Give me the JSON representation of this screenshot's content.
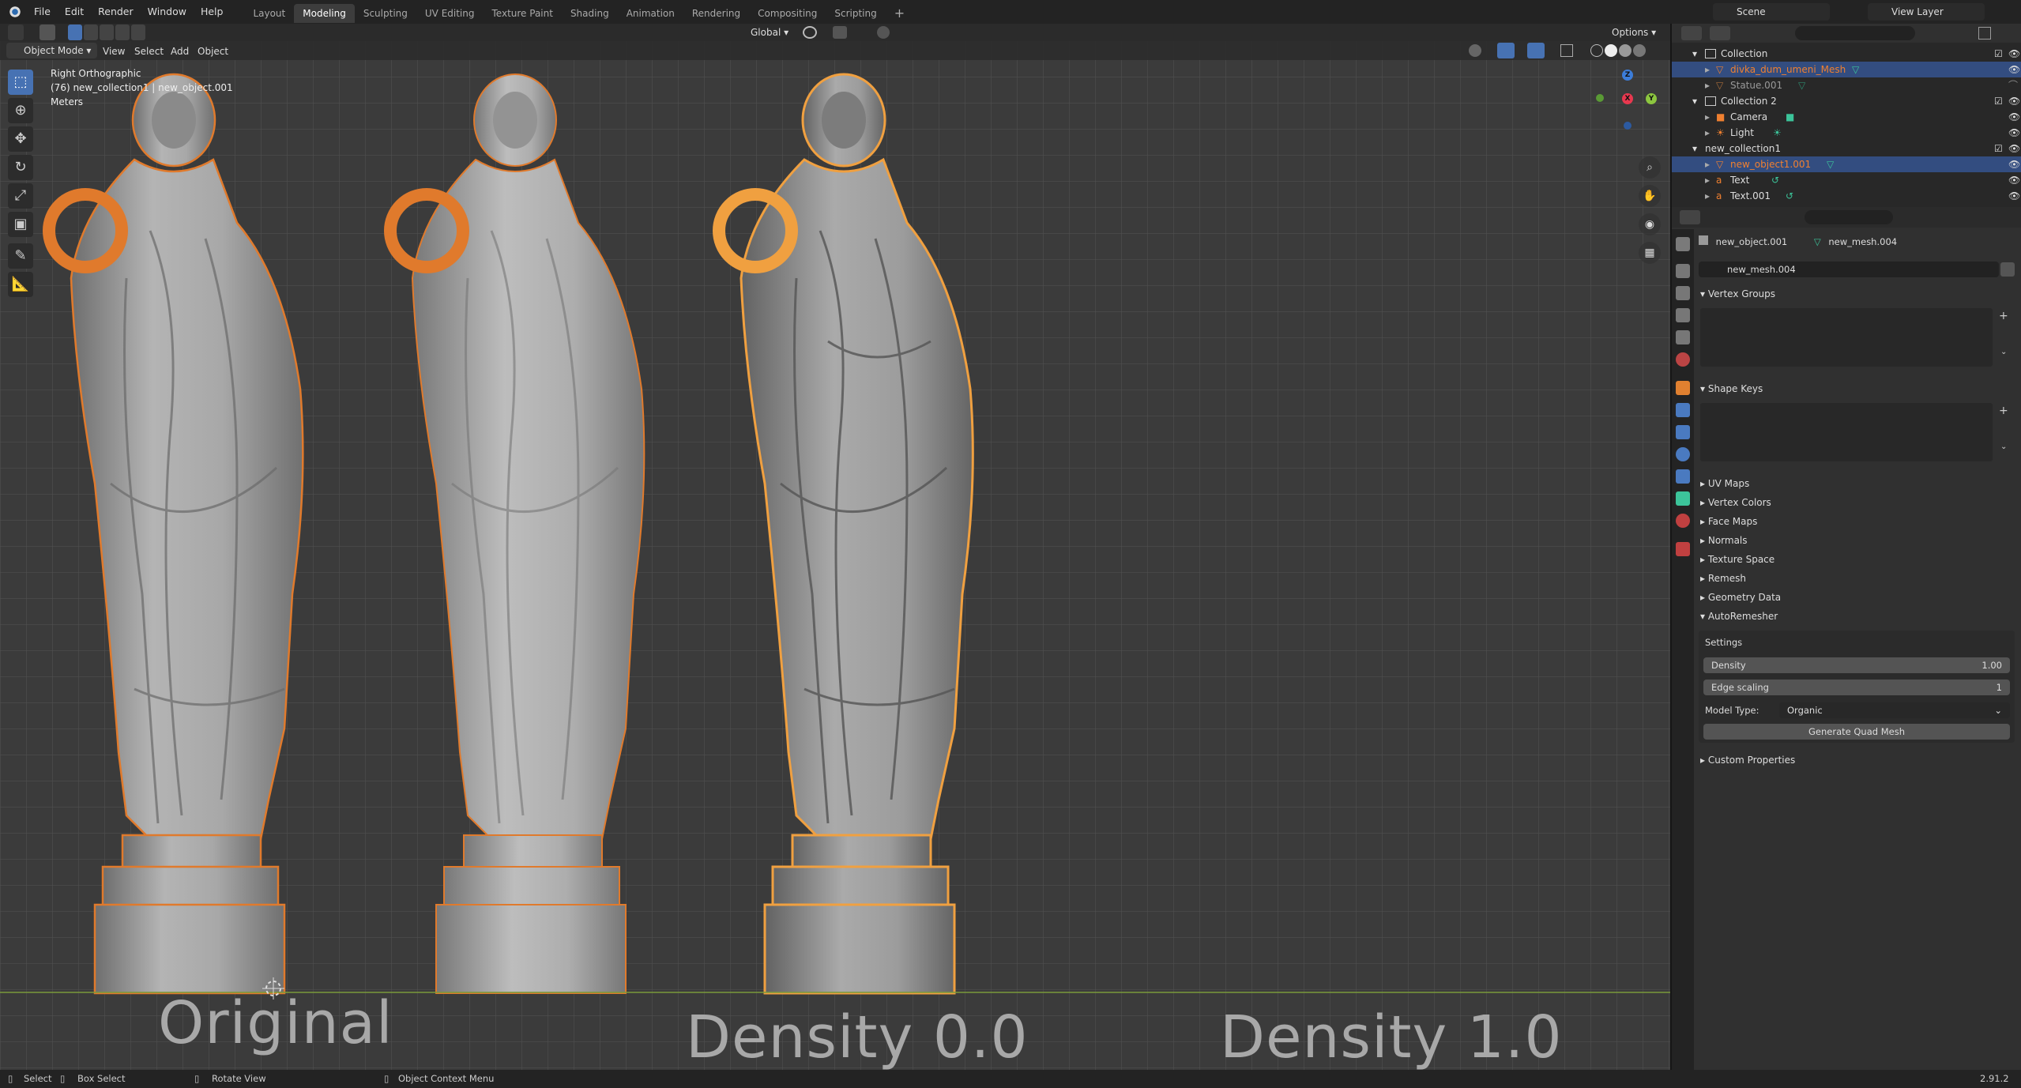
{
  "menubar": {
    "items": [
      "File",
      "Edit",
      "Render",
      "Window",
      "Help"
    ],
    "workspaces": [
      "Layout",
      "Modeling",
      "Sculpting",
      "UV Editing",
      "Texture Paint",
      "Shading",
      "Animation",
      "Rendering",
      "Compositing",
      "Scripting"
    ],
    "active_workspace": "Modeling",
    "scene": "Scene",
    "view_layer": "View Layer"
  },
  "viewport_header": {
    "mode": "Object Mode",
    "menus": [
      "View",
      "Select",
      "Add",
      "Object"
    ],
    "transform_orientation": "Global",
    "options": "Options"
  },
  "viewport": {
    "view_name": "Right Orthographic",
    "object_info": "(76) new_collection1 | new_object.001",
    "units": "Meters",
    "captions": [
      "Original",
      "Density 0.0",
      "Density 1.0"
    ]
  },
  "outliner": {
    "rows": [
      {
        "label": "Collection",
        "type": "collection"
      },
      {
        "label": "divka_dum_umeni_Mesh",
        "type": "mesh"
      },
      {
        "label": "Statue.001",
        "type": "mesh"
      },
      {
        "label": "Collection 2",
        "type": "collection"
      },
      {
        "label": "Camera",
        "type": "camera"
      },
      {
        "label": "Light",
        "type": "light"
      },
      {
        "label": "new_collection1",
        "type": "collection"
      },
      {
        "label": "new_object1.001",
        "type": "mesh"
      },
      {
        "label": "Text",
        "type": "text"
      },
      {
        "label": "Text.001",
        "type": "text"
      }
    ]
  },
  "properties": {
    "object_name": "new_object.001",
    "mesh_name": "new_mesh.004",
    "datablock": "new_mesh.004",
    "panels": {
      "vertex_groups": "Vertex Groups",
      "shape_keys": "Shape Keys",
      "uv_maps": "UV Maps",
      "vertex_colors": "Vertex Colors",
      "face_maps": "Face Maps",
      "normals": "Normals",
      "texture_space": "Texture Space",
      "remesh": "Remesh",
      "geometry_data": "Geometry Data",
      "autoremesher": "AutoRemesher",
      "custom_properties": "Custom Properties"
    },
    "settings": {
      "title": "Settings",
      "density_label": "Density",
      "density_value": "1.00",
      "edge_scaling_label": "Edge scaling",
      "edge_scaling_value": "1",
      "model_type_label": "Model Type:",
      "model_type_value": "Organic",
      "generate_button": "Generate Quad Mesh"
    }
  },
  "statusbar": {
    "select": "Select",
    "box_select": "Box Select",
    "rotate_view": "Rotate View",
    "context_menu": "Object Context Menu",
    "version": "2.91.2"
  }
}
